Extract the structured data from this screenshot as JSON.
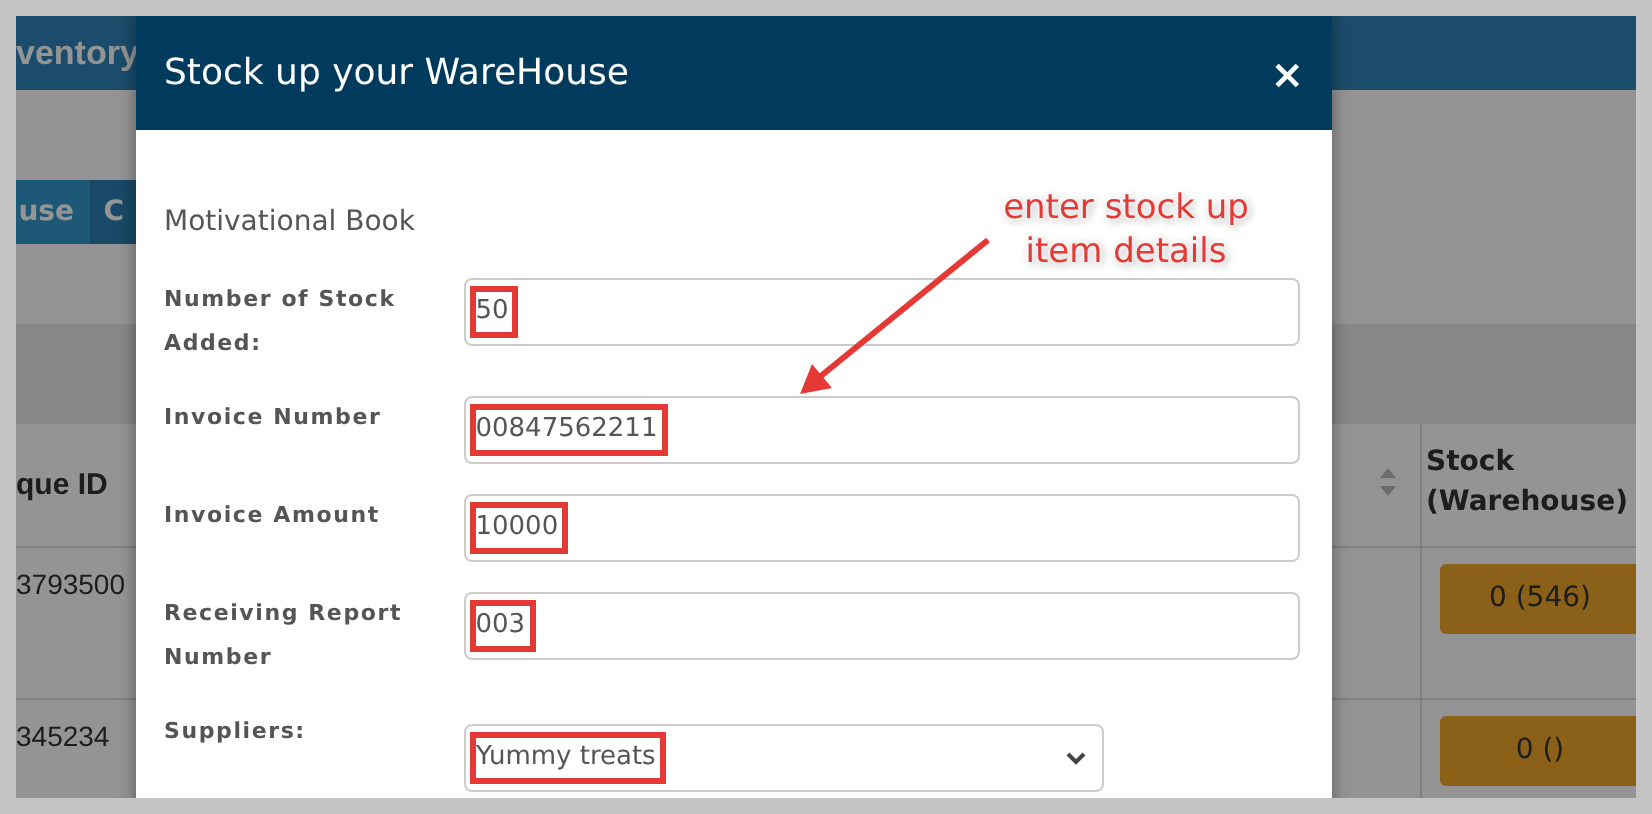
{
  "app": {
    "title": "ventory",
    "tabs": [
      {
        "label": "use",
        "selected": true
      },
      {
        "label": "C",
        "selected": false
      }
    ],
    "table": {
      "columns": [
        "que ID",
        "Stock (Warehouse)"
      ],
      "rows": [
        {
          "id": "3793500",
          "stock": "0 (546)"
        },
        {
          "id": "345234",
          "stock": "0 ()"
        }
      ]
    }
  },
  "modal": {
    "title": "Stock up your WareHouse",
    "close": "×",
    "product": "Motivational Book",
    "fields": [
      {
        "label": "Number of Stock Added:",
        "value": "50",
        "kind": "text"
      },
      {
        "label": "Invoice Number",
        "value": "00847562211",
        "kind": "text"
      },
      {
        "label": "Invoice Amount",
        "value": "10000",
        "kind": "text"
      },
      {
        "label": "Receiving Report Number",
        "value": "003",
        "kind": "text"
      },
      {
        "label": "Suppliers:",
        "value": "Yummy treats",
        "kind": "select"
      }
    ]
  },
  "annotation": {
    "text": "enter stock up item details"
  }
}
